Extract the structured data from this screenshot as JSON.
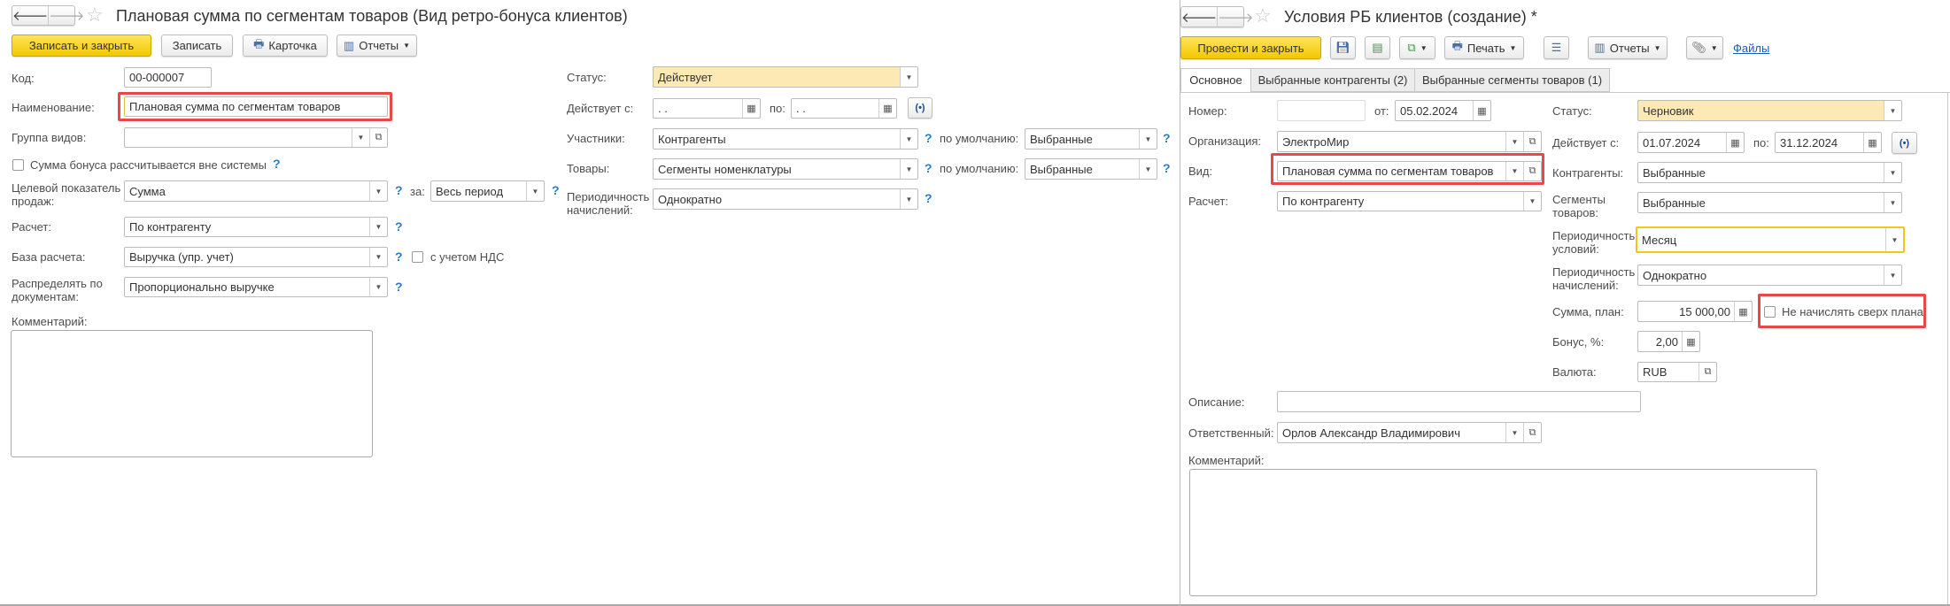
{
  "left": {
    "title": "Плановая сумма по сегментам товаров (Вид ретро-бонуса клиентов)",
    "toolbar": {
      "save_close": "Записать и закрыть",
      "save": "Записать",
      "card": "Карточка",
      "reports": "Отчеты"
    },
    "code": {
      "label": "Код:",
      "value": "00-000007"
    },
    "name": {
      "label": "Наименование:",
      "value": "Плановая сумма по сегментам товаров"
    },
    "group": {
      "label": "Группа видов:",
      "value": ""
    },
    "outside": {
      "label": "Сумма бонуса рассчитывается вне системы",
      "checked": false
    },
    "target": {
      "label1": "Целевой показатель",
      "label2": "продаж:",
      "value": "Сумма",
      "for_label": "за:",
      "for_value": "Весь период"
    },
    "calc": {
      "label": "Расчет:",
      "value": "По контрагенту"
    },
    "base": {
      "label": "База расчета:",
      "value": "Выручка (упр. учет)",
      "vat_label": "с учетом НДС",
      "vat_checked": false
    },
    "distribute": {
      "label1": "Распределять по",
      "label2": "документам:",
      "value": "Пропорционально выручке"
    },
    "comment": {
      "label": "Комментарий:",
      "value": ""
    },
    "status": {
      "label": "Статус:",
      "value": "Действует"
    },
    "valid": {
      "label": "Действует с:",
      "from": " .  .",
      "to_label": "по:",
      "to": " .  ."
    },
    "participants": {
      "label": "Участники:",
      "value": "Контрагенты",
      "default_label": "по умолчанию:",
      "default_value": "Выбранные"
    },
    "goods": {
      "label": "Товары:",
      "value": "Сегменты номенклатуры",
      "default_label": "по умолчанию:",
      "default_value": "Выбранные"
    },
    "period": {
      "label1": "Периодичность",
      "label2": "начислений:",
      "value": "Однократно"
    },
    "help": "?"
  },
  "right": {
    "title": "Условия РБ клиентов (создание) *",
    "toolbar": {
      "post_close": "Провести и закрыть",
      "print": "Печать",
      "reports": "Отчеты",
      "files": "Файлы"
    },
    "tabs": [
      {
        "label": "Основное",
        "active": true
      },
      {
        "label": "Выбранные контрагенты (2)"
      },
      {
        "label": "Выбранные сегменты товаров (1)"
      }
    ],
    "number": {
      "label": "Номер:",
      "value": "",
      "date_label": "от:",
      "date": "05.02.2024"
    },
    "org": {
      "label": "Организация:",
      "value": "ЭлектроМир"
    },
    "kind": {
      "label": "Вид:",
      "value": "Плановая сумма по сегментам товаров"
    },
    "calc": {
      "label": "Расчет:",
      "value": "По контрагенту"
    },
    "status": {
      "label": "Статус:",
      "value": "Черновик"
    },
    "valid": {
      "label": "Действует с:",
      "from": "01.07.2024",
      "to_label": "по:",
      "to": "31.12.2024"
    },
    "counterparties": {
      "label": "Контрагенты:",
      "value": "Выбранные"
    },
    "segments": {
      "label1": "Сегменты",
      "label2": "товаров:",
      "value": "Выбранные"
    },
    "cond_period": {
      "label1": "Периодичность",
      "label2": "условий:",
      "value": "Месяц"
    },
    "accr_period": {
      "label1": "Периодичность",
      "label2": "начислений:",
      "value": "Однократно"
    },
    "plan": {
      "label": "Сумма, план:",
      "value": "15 000,00",
      "no_over_label": "Не начислять сверх плана",
      "no_over_checked": false
    },
    "bonus": {
      "label": "Бонус, %:",
      "value": "2,00"
    },
    "currency": {
      "label": "Валюта:",
      "value": "RUB"
    },
    "description": {
      "label": "Описание:",
      "value": ""
    },
    "responsible": {
      "label": "Ответственный:",
      "value": "Орлов Александр Владимирович"
    },
    "comment": {
      "label": "Комментарий:",
      "value": ""
    }
  },
  "colors": {
    "accent_button": "#f2c800",
    "status_bg": "#fde9b3",
    "highlight": "#e84848",
    "focus": "#f5c518",
    "help": "#2a7bc4"
  }
}
